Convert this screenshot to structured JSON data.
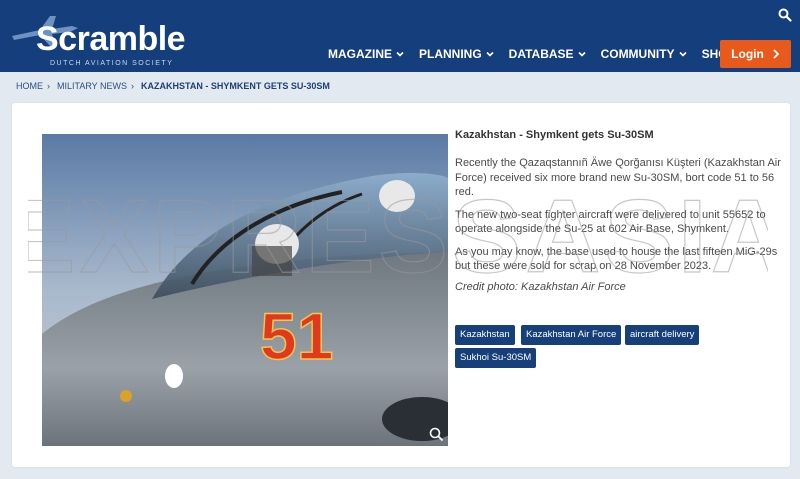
{
  "header": {
    "logo_text": "Scramble",
    "logo_subtitle": "DUTCH AVIATION SOCIETY",
    "nav": [
      {
        "label": "MAGAZINE"
      },
      {
        "label": "PLANNING"
      },
      {
        "label": "DATABASE"
      },
      {
        "label": "COMMUNITY"
      },
      {
        "label": "SHOP"
      }
    ],
    "login_label": "Login"
  },
  "breadcrumb": {
    "home": "HOME",
    "section": "MILITARY NEWS",
    "current": "KAZAKHSTAN - SHYMKENT GETS SU-30SM"
  },
  "article": {
    "title": "Kazakhstan - Shymkent gets Su-30SM",
    "paragraphs": [
      "Recently the Qazaqstannıñ Äwe Qorğanısı Küşteri (Kazakhstan Air Force) received six more brand new Su-30SM, bort code 51 to 56 red.",
      "The new two-seat fighter aircraft were delivered to unit 55652 to operate alongside the Su-25 at 602 Air Base, Shymkent.",
      "As you may know, the base used to house the last fifteen MiG-29s but these were sold for scrap on 28 November 2023."
    ],
    "credit": "Credit photo: Kazakhstan Air Force",
    "tags": [
      "Kazakhstan",
      "Kazakhstan Air Force",
      "aircraft delivery",
      "Sukhoi Su-30SM"
    ]
  },
  "photo": {
    "bort_code": "51"
  },
  "watermark": "EXPRESSASIA",
  "colors": {
    "header_bg": "#143e7c",
    "login_bg": "#e8591c",
    "tag_bg": "#173f7a",
    "page_bg": "#e3e9f1"
  }
}
